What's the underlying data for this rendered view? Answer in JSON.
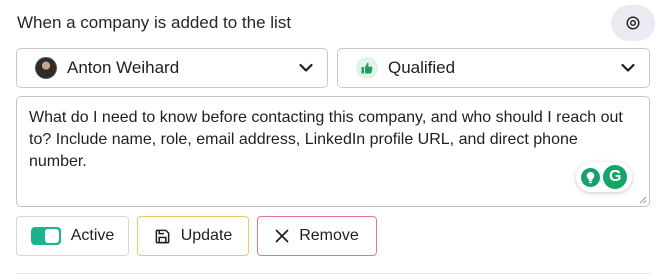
{
  "header": {
    "title": "When a company is added to the list",
    "action_icon": "at-sign-icon"
  },
  "owner_select": {
    "value": "Anton Weihard",
    "icon": "avatar",
    "chevron": "chevron-down-icon"
  },
  "status_select": {
    "value": "Qualified",
    "icon": "thumbs-up-icon",
    "accent": "#1a9f5c",
    "chevron": "chevron-down-icon"
  },
  "prompt": {
    "text": "What do I need to know before contacting this company, and who should I reach out to? Include name, role, email address, LinkedIn profile URL, and direct phone number.",
    "assistant_letter": "G"
  },
  "actions": {
    "active_label": "Active",
    "active_on": true,
    "toggle_color": "#1bb38c",
    "update_label": "Update",
    "update_border": "#f4c764",
    "remove_label": "Remove",
    "remove_border": "#e9758d"
  }
}
